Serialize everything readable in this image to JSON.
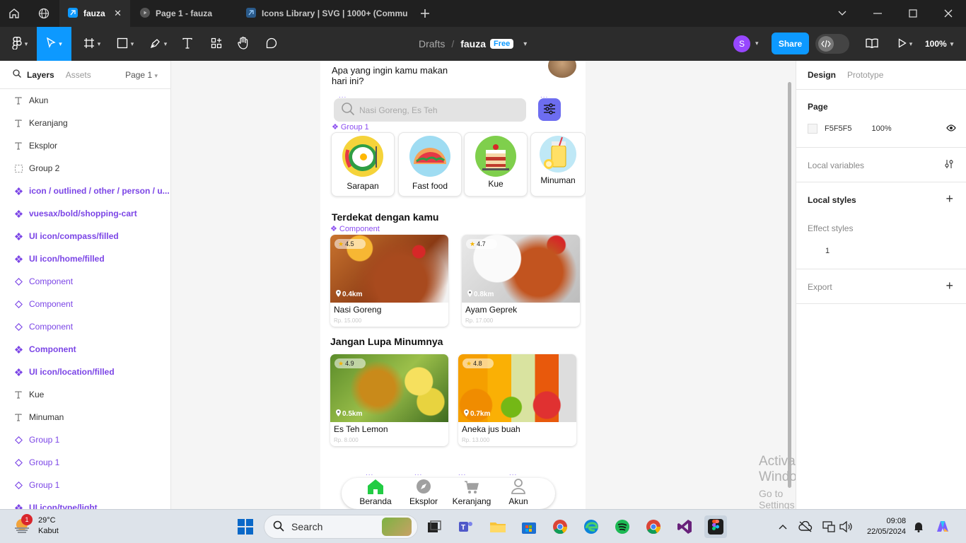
{
  "browser": {
    "tabs": [
      {
        "label": "fauza",
        "active": true
      },
      {
        "label": "Page 1 - fauza",
        "active": false
      },
      {
        "label": "Icons Library | SVG | 1000+ (Commu",
        "active": false
      }
    ]
  },
  "toolbar": {
    "drafts": "Drafts",
    "separator": "/",
    "file_name": "fauza",
    "plan_badge": "Free",
    "user_initial": "S",
    "share_label": "Share",
    "zoom": "100%"
  },
  "left_panel": {
    "tab_layers": "Layers",
    "tab_assets": "Assets",
    "page_selector": "Page 1",
    "layers": [
      {
        "label": "Akun",
        "type": "text"
      },
      {
        "label": "Keranjang",
        "type": "text"
      },
      {
        "label": "Eksplor",
        "type": "text"
      },
      {
        "label": "Group 2",
        "type": "group"
      },
      {
        "label": "icon / outlined / other / person / u...",
        "type": "component"
      },
      {
        "label": "vuesax/bold/shopping-cart",
        "type": "component"
      },
      {
        "label": "UI icon/compass/filled",
        "type": "component"
      },
      {
        "label": "UI icon/home/filled",
        "type": "component"
      },
      {
        "label": "Component",
        "type": "instance"
      },
      {
        "label": "Component",
        "type": "instance"
      },
      {
        "label": "Component",
        "type": "instance"
      },
      {
        "label": "Component",
        "type": "component"
      },
      {
        "label": "UI icon/location/filled",
        "type": "component"
      },
      {
        "label": "Kue",
        "type": "text"
      },
      {
        "label": "Minuman",
        "type": "text"
      },
      {
        "label": "Group 1",
        "type": "instance"
      },
      {
        "label": "Group 1",
        "type": "instance"
      },
      {
        "label": "Group 1",
        "type": "instance"
      },
      {
        "label": "UI icon/type/light",
        "type": "component"
      }
    ]
  },
  "app": {
    "question": "Apa yang ingin kamu makan hari ini?",
    "search_placeholder": "Nasi Goreng, Es Teh",
    "group_label": "Group 1",
    "component_label": "Component",
    "categories": [
      {
        "label": "Sarapan",
        "bg": "#f5d33a"
      },
      {
        "label": "Fast food",
        "bg": "#9fdcf2"
      },
      {
        "label": "Kue",
        "bg": "#7fcf4c"
      },
      {
        "label": "Minuman",
        "bg": "#bfe8f6"
      }
    ],
    "section_nearby": "Terdekat dengan kamu",
    "section_drinks": "Jangan Lupa Minumnya",
    "nearby": [
      {
        "rating": "4.5",
        "distance": "0.4km",
        "name": "Nasi Goreng",
        "price": "Rp. 15.000"
      },
      {
        "rating": "4.7",
        "distance": "0.8km",
        "name": "Ayam Geprek",
        "price": "Rp. 17.000"
      }
    ],
    "drinks": [
      {
        "rating": "4.9",
        "distance": "0.5km",
        "name": "Es Teh Lemon",
        "price": "Rp. 8.000"
      },
      {
        "rating": "4.8",
        "distance": "0.7km",
        "name": "Aneka jus buah",
        "price": "Rp. 13.000"
      }
    ],
    "nav": [
      {
        "label": "Beranda",
        "icon": "home-icon",
        "color": "#22cc44"
      },
      {
        "label": "Eksplor",
        "icon": "compass-icon",
        "color": "#a0a0a0"
      },
      {
        "label": "Keranjang",
        "icon": "shopping-cart-icon",
        "color": "#a0a0a0"
      },
      {
        "label": "Akun",
        "icon": "person-icon",
        "color": "#a0a0a0"
      }
    ]
  },
  "right_panel": {
    "tab_design": "Design",
    "tab_prototype": "Prototype",
    "page_title": "Page",
    "page_color": "F5F5F5",
    "page_opacity": "100%",
    "local_variables": "Local variables",
    "local_styles": "Local styles",
    "effect_styles": "Effect styles",
    "effect_count": "1",
    "export": "Export"
  },
  "watermark": {
    "line1": "Activate Windows",
    "line2": "Go to Settings to activate Windows."
  },
  "taskbar": {
    "temperature": "29°C",
    "weather": "Kabut",
    "notification_count": "1",
    "search_placeholder": "Search",
    "time": "09:08",
    "date": "22/05/2024"
  },
  "colors": {
    "accent": "#0d99ff",
    "component_purple": "#7b45e6",
    "filter_button": "#6d6df0",
    "canvas_bg": "#F5F5F5"
  }
}
